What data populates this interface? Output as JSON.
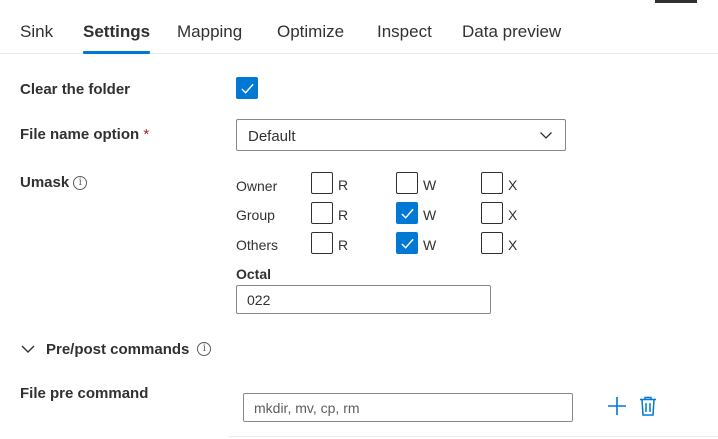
{
  "tabs": [
    {
      "label": "Sink"
    },
    {
      "label": "Settings"
    },
    {
      "label": "Mapping"
    },
    {
      "label": "Optimize"
    },
    {
      "label": "Inspect"
    },
    {
      "label": "Data preview"
    }
  ],
  "active_tab": "Settings",
  "clear_folder": {
    "label": "Clear the folder",
    "checked": true
  },
  "file_name_option": {
    "label": "File name option",
    "required_mark": "*",
    "value": "Default"
  },
  "umask": {
    "label": "Umask",
    "info_icon": "info-icon",
    "rows": [
      {
        "name": "Owner",
        "perms": [
          {
            "letter": "R",
            "checked": false
          },
          {
            "letter": "W",
            "checked": false
          },
          {
            "letter": "X",
            "checked": false
          }
        ]
      },
      {
        "name": "Group",
        "perms": [
          {
            "letter": "R",
            "checked": false
          },
          {
            "letter": "W",
            "checked": true
          },
          {
            "letter": "X",
            "checked": false
          }
        ]
      },
      {
        "name": "Others",
        "perms": [
          {
            "letter": "R",
            "checked": false
          },
          {
            "letter": "W",
            "checked": true
          },
          {
            "letter": "X",
            "checked": false
          }
        ]
      }
    ],
    "octal_label": "Octal",
    "octal_value": "022"
  },
  "pre_post": {
    "label": "Pre/post commands",
    "expanded": true,
    "info_icon": "info-icon"
  },
  "file_pre_command": {
    "label": "File pre command",
    "value": "",
    "placeholder": "mkdir, mv, cp, rm",
    "add_icon": "plus-icon",
    "delete_icon": "trash-icon"
  },
  "colors": {
    "accent": "#0078d4",
    "text": "#323130",
    "border": "#8a8886"
  }
}
